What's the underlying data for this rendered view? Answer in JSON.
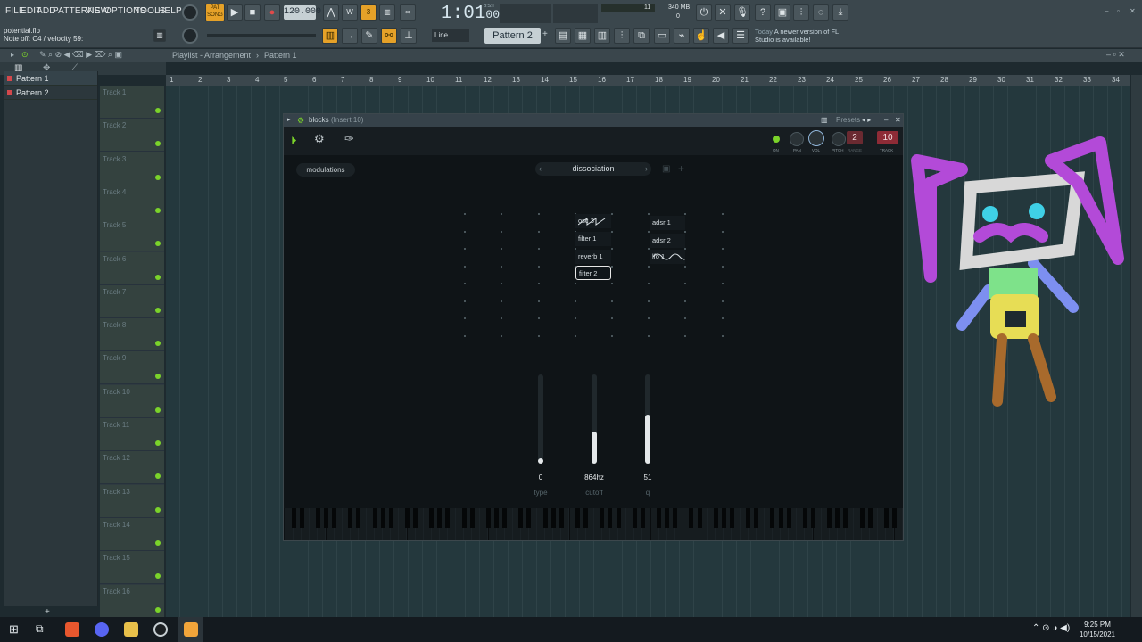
{
  "menu": [
    "FILE",
    "EDIT",
    "ADD",
    "PATTERNS",
    "VIEW",
    "OPTIONS",
    "TOOLS",
    "HELP"
  ],
  "transport": {
    "pat_label": "PAT",
    "song_label": "SONG",
    "bpm": "120.000",
    "time": "1:01",
    "time_sub": "00",
    "bst": "B:S:T"
  },
  "hint": {
    "file": "potential.flp",
    "note": "Note off: C4 / velocity 59:"
  },
  "cpu": {
    "value": "11",
    "memory": "340 MB",
    "poly": "0"
  },
  "snap": "Line",
  "pattern_selector": "Pattern 2",
  "news": {
    "when": "Today",
    "text": "A newer version of FL Studio is available!"
  },
  "playlist": {
    "title": "Playlist - Arrangement",
    "pattern": "Pattern 1"
  },
  "patterns": [
    "Pattern 1",
    "Pattern 2"
  ],
  "tracks": [
    "Track 1",
    "Track 2",
    "Track 3",
    "Track 4",
    "Track 5",
    "Track 6",
    "Track 7",
    "Track 8",
    "Track 9",
    "Track 10",
    "Track 11",
    "Track 12",
    "Track 13",
    "Track 14",
    "Track 15",
    "Track 16"
  ],
  "ruler": [
    "1",
    "2",
    "3",
    "4",
    "5",
    "6",
    "7",
    "8",
    "9",
    "10",
    "11",
    "12",
    "13",
    "14",
    "15",
    "16",
    "17",
    "18",
    "19",
    "20",
    "21",
    "22",
    "23",
    "24",
    "25",
    "26",
    "27",
    "28",
    "29",
    "30",
    "31",
    "32",
    "33",
    "34"
  ],
  "plugin": {
    "title": "blocks",
    "insert": "(Insert 10)",
    "presets": "Presets",
    "header_labels": {
      "on": "ON",
      "pan": "PAN",
      "vol": "VOL",
      "pitch": "PITCH",
      "range": "RANGE",
      "track": "TRACK"
    },
    "range_value": "2",
    "track_value": "10",
    "modulations": "modulations",
    "preset_name": "dissociation",
    "blocks_col1": [
      "osc 3",
      "filter 1",
      "reverb 1",
      "filter 2"
    ],
    "blocks_col2": [
      "adsr 1",
      "adsr 2",
      "lfo 1"
    ],
    "params": [
      {
        "value": "0",
        "label": "type",
        "level": 0.0
      },
      {
        "value": "864hz",
        "label": "cutoff",
        "level": 0.36
      },
      {
        "value": "51",
        "label": "q",
        "level": 0.55
      }
    ]
  },
  "clock": {
    "time": "9:25 PM",
    "date": "10/15/2021"
  }
}
